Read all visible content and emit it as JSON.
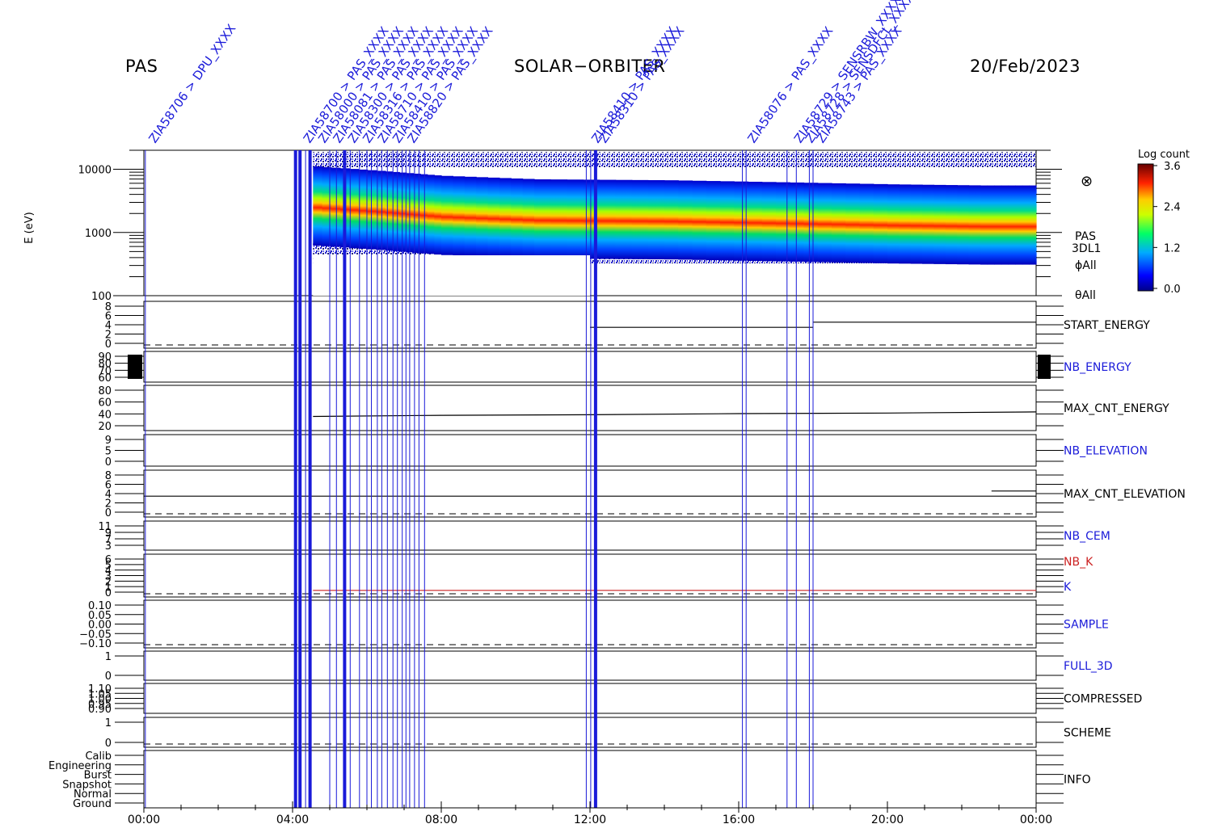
{
  "header": {
    "instrument": "PAS",
    "mission": "SOLAR−ORBITER",
    "date": "20/Feb/2023"
  },
  "colorbar": {
    "title": "Log count",
    "ticks": [
      "3.6",
      "2.4",
      "1.2",
      "0.0"
    ]
  },
  "spectrogram_labels": {
    "symbol": "⊗",
    "product": "PAS",
    "mode": "3DL1",
    "phi": "ϕAll",
    "theta": "θAll"
  },
  "colors": {
    "command_line": "#1a1ad9",
    "nb_k": "#cc2222",
    "label_blue": "#1a1ad9",
    "axis": "#000000"
  },
  "command_labels": [
    {
      "text": "ZIA58706 > DPU_XXXX"
    },
    {
      "text": "ZIA58700 > PAS_XXXX"
    },
    {
      "text": "ZIA58000 > PAS_XXXX"
    },
    {
      "text": "ZIA58081 > PAS_XXXX"
    },
    {
      "text": "ZIA58300 > PAS_XXXX"
    },
    {
      "text": "ZIA58316 > PAS_XXXX"
    },
    {
      "text": "ZIA58710 > PAS_XXXX"
    },
    {
      "text": "ZIA58410 > PAS_XXXX"
    },
    {
      "text": "ZIA58820 > PAS_XXXX"
    },
    {
      "text": "ZIA58410 > PAS_XXXX"
    },
    {
      "text": "ZIA58310 > PAS_XXXX"
    },
    {
      "text": "ZIA58076 > PAS_XXXX"
    },
    {
      "text": "ZIA58729 > SENSRBW_XXXX"
    },
    {
      "text": "ZIA58728 > SENSDFCL_XXXX"
    },
    {
      "text": "ZIA58743 > PAS_XXXX"
    }
  ],
  "chart_data": {
    "type": "stacked-timeseries",
    "xaxis": {
      "range_hours": [
        0,
        24
      ],
      "ticks": [
        {
          "hour": 0,
          "label": "00:00"
        },
        {
          "hour": 4,
          "label": "04:00"
        },
        {
          "hour": 8,
          "label": "08:00"
        },
        {
          "hour": 12,
          "label": "12:00"
        },
        {
          "hour": 16,
          "label": "16:00"
        },
        {
          "hour": 20,
          "label": "20:00"
        },
        {
          "hour": 24,
          "label": "00:00"
        }
      ]
    },
    "command_times_hours": [
      0.04,
      4.08,
      4.2,
      4.35,
      4.47,
      5.0,
      5.18,
      5.4,
      5.55,
      5.8,
      6.0,
      6.12,
      6.28,
      6.4,
      6.55,
      6.7,
      6.82,
      6.95,
      7.05,
      7.15,
      7.28,
      7.4,
      7.55,
      11.9,
      12.02,
      12.15,
      16.1,
      16.2,
      17.3,
      17.55,
      17.9,
      18.0
    ],
    "thick_command_times_hours": [
      4.08,
      4.2,
      4.47,
      5.4,
      12.15
    ],
    "spectrogram": {
      "ylabel": "E (eV)",
      "yscale": "log",
      "ylim": [
        100,
        20000
      ],
      "yticks": [
        "10000",
        "1000",
        "100"
      ],
      "data_start_hour": 4.55,
      "data_end_hour": 24,
      "colorbar_range": [
        0.0,
        3.6
      ],
      "peak_energy_profile": [
        {
          "hour": 4.55,
          "energy": 2400
        },
        {
          "hour": 6.5,
          "energy": 2000
        },
        {
          "hour": 8.0,
          "energy": 1700
        },
        {
          "hour": 10.5,
          "energy": 1500
        },
        {
          "hour": 14.0,
          "energy": 1450
        },
        {
          "hour": 17.0,
          "energy": 1350
        },
        {
          "hour": 20.0,
          "energy": 1250
        },
        {
          "hour": 22.5,
          "energy": 1200
        },
        {
          "hour": 24.0,
          "energy": 1200
        }
      ]
    },
    "panels": [
      {
        "id": "start-energy",
        "label": "START_ENERGY",
        "yticks": [
          "8",
          "6",
          "4",
          "2",
          "0"
        ],
        "ylim": [
          0,
          9
        ],
        "series": [
          {
            "x": [
              12.0,
              18.0
            ],
            "y": [
              4,
              4
            ]
          },
          {
            "x": [
              18.0,
              24.0
            ],
            "y": [
              5,
              5
            ]
          }
        ],
        "zero_dashed": true
      },
      {
        "id": "nb-energy",
        "label": "NB_ENERGY",
        "yticks": [
          "90",
          "80",
          "70",
          "60"
        ],
        "ylim": [
          58,
          94
        ],
        "series": [],
        "zero_dashed": false
      },
      {
        "id": "max-cnt-energy",
        "label": "MAX_CNT_ENERGY",
        "yticks": [
          "80",
          "60",
          "40",
          "20"
        ],
        "ylim": [
          10,
          90
        ],
        "series": [
          {
            "x": [
              4.55,
              8.0,
              12.0,
              16.0,
              20.0,
              24.0
            ],
            "y": [
              35,
              37,
              38,
              40,
              41,
              43
            ]
          }
        ],
        "zero_dashed": false
      },
      {
        "id": "nb-elevation",
        "label": "NB_ELEVATION",
        "yticks": [
          "9",
          "5",
          "0"
        ],
        "ylim": [
          0,
          10
        ],
        "series": [],
        "zero_dashed": false
      },
      {
        "id": "max-cnt-elevation",
        "label": "MAX_CNT_ELEVATION",
        "yticks": [
          "8",
          "6",
          "4",
          "2",
          "0"
        ],
        "ylim": [
          0,
          9
        ],
        "series": [
          {
            "x": [
              0,
              24
            ],
            "y": [
              4,
              4
            ]
          },
          {
            "x": [
              22.8,
              24
            ],
            "y": [
              5,
              5
            ]
          }
        ],
        "zero_dashed": true
      },
      {
        "id": "nb-cem",
        "label": "NB_CEM",
        "yticks": [
          "11",
          "9",
          "7",
          "3"
        ],
        "ylim": [
          1,
          12
        ],
        "series": [],
        "zero_dashed": false
      },
      {
        "id": "k",
        "label": "NB_K",
        "label2": "K",
        "yticks": [
          "6",
          "5",
          "4",
          "3",
          "2",
          "1",
          "0"
        ],
        "ylim": [
          0,
          6.5
        ],
        "series": [
          {
            "x": [
              4.55,
              24
            ],
            "y": [
              1,
              1
            ],
            "color": "nb_k"
          }
        ],
        "zero_dashed": true
      },
      {
        "id": "sample",
        "label": "SAMPLE",
        "yticks": [
          "0.10",
          "0.05",
          "0.00",
          "−0.05",
          "−0.10"
        ],
        "ylim": [
          -0.12,
          0.12
        ],
        "series": [],
        "zero_dashed": true
      },
      {
        "id": "full-3d",
        "label": "FULL_3D",
        "yticks": [
          "1",
          "0"
        ],
        "ylim": [
          -0.6,
          1.6
        ],
        "series": [],
        "zero_dashed": false
      },
      {
        "id": "compressed",
        "label": "COMPRESSED",
        "yticks": [
          "1.10",
          "1.05",
          "1.00",
          "0.95",
          "0.90"
        ],
        "ylim": [
          0.88,
          1.12
        ],
        "series": [],
        "zero_dashed": false
      },
      {
        "id": "scheme",
        "label": "SCHEME",
        "yticks": [
          "1",
          "0"
        ],
        "ylim": [
          -0.3,
          1.6
        ],
        "series": [],
        "zero_dashed": true
      },
      {
        "id": "info",
        "label": "INFO",
        "yticks": [
          "Calib",
          "Engineering",
          "Burst",
          "Snapshot",
          "Normal",
          "Ground"
        ],
        "ylim": [
          0,
          6
        ],
        "series": [],
        "zero_dashed": false
      }
    ]
  }
}
